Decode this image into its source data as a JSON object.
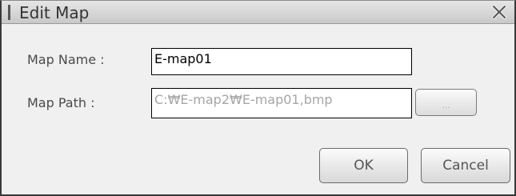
{
  "window": {
    "title": "Edit Map",
    "close_icon": "close-icon"
  },
  "form": {
    "map_name_label": "Map Name :",
    "map_name_value": "E-map01",
    "map_path_label": "Map Path :",
    "map_path_value": "C:₩E-map2₩E-map01,bmp",
    "browse_label": "..."
  },
  "buttons": {
    "ok_label": "OK",
    "cancel_label": "Cancel"
  }
}
